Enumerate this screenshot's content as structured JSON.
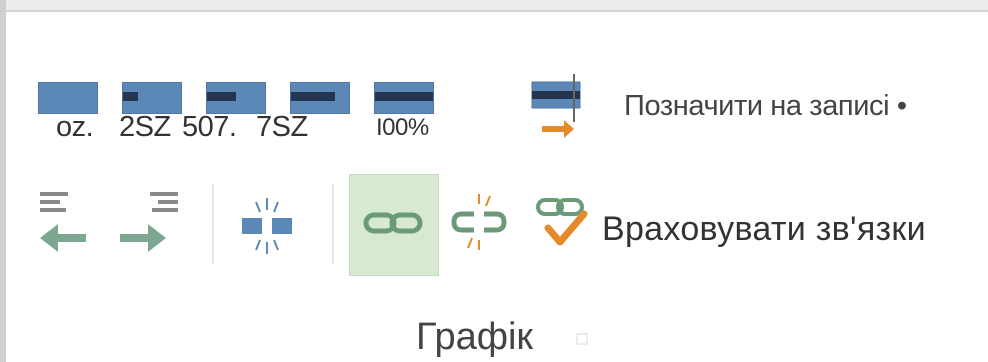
{
  "ribbon": {
    "percent_buttons": [
      {
        "label": "oz.",
        "percent_complete": 0
      },
      {
        "label": "2SZ",
        "percent_complete": 25
      },
      {
        "label": "507.",
        "percent_complete": 50
      },
      {
        "label": "7SZ",
        "percent_complete": 75
      },
      {
        "label": "I00%",
        "percent_complete": 100
      }
    ],
    "mark_on_track": {
      "label": "Позначити на записі •",
      "icon": "mark-on-track-icon"
    },
    "outdent_icon": "outdent-task-icon",
    "indent_icon": "indent-task-icon",
    "split_icon": "split-task-icon",
    "link_icon": "link-tasks-icon",
    "unlink_icon": "unlink-tasks-icon",
    "respect_links": {
      "label": "Враховувати зв'язки",
      "icon": "respect-links-icon"
    },
    "group_title": "Графік",
    "colors": {
      "bar": "#5b88b7",
      "bar_fill": "#24364f",
      "green": "#6a9a78",
      "orange": "#e48a2a",
      "selected_bg": "#d7e9d3"
    }
  }
}
